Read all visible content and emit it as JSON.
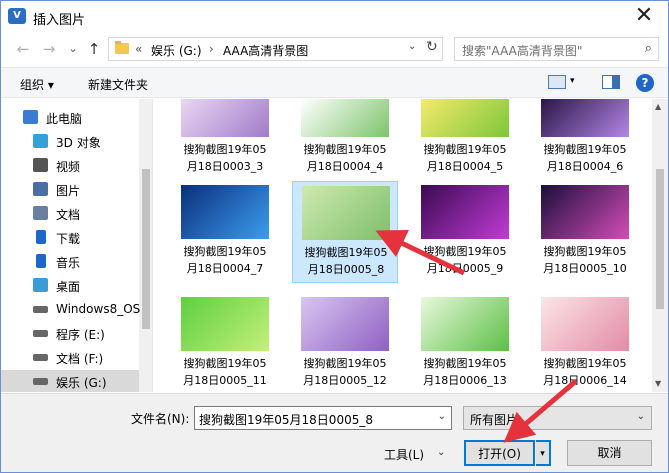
{
  "window": {
    "title": "插入图片",
    "app_icon_text": "V",
    "close_label": "✕"
  },
  "nav": {
    "back": "←",
    "forward": "→",
    "dropdown": "⌄",
    "up": "↑"
  },
  "address": {
    "sep": "«",
    "crumbs": [
      "娱乐 (G:)",
      "AAA高清背景图"
    ],
    "crumb_sep": "›",
    "dropdown": "⌄",
    "refresh": "↻"
  },
  "search": {
    "placeholder": "搜索\"AAA高清背景图\"",
    "icon": "⌕"
  },
  "toolbar": {
    "organize": "组织 ▾",
    "new_folder": "新建文件夹",
    "help": "?"
  },
  "sidebar": {
    "items": [
      {
        "label": "此电脑",
        "icon": "computer-icon",
        "color": "#3a7bd5"
      },
      {
        "label": "3D 对象",
        "icon": "cube-icon",
        "color": "#35a0d8"
      },
      {
        "label": "视频",
        "icon": "film-icon",
        "color": "#555555"
      },
      {
        "label": "图片",
        "icon": "picture-icon",
        "color": "#4a6fa5"
      },
      {
        "label": "文档",
        "icon": "document-icon",
        "color": "#6b7fa0"
      },
      {
        "label": "下载",
        "icon": "download-icon",
        "color": "#1e66c8"
      },
      {
        "label": "音乐",
        "icon": "music-icon",
        "color": "#1e66c8"
      },
      {
        "label": "桌面",
        "icon": "desktop-icon",
        "color": "#3a9bd5"
      },
      {
        "label": "Windows8_OS",
        "icon": "drive-icon",
        "color": "#666666"
      },
      {
        "label": "程序 (E:)",
        "icon": "drive-icon",
        "color": "#666666"
      },
      {
        "label": "文档 (F:)",
        "icon": "drive-icon",
        "color": "#666666"
      },
      {
        "label": "娱乐 (G:)",
        "icon": "drive-icon",
        "color": "#666666"
      }
    ]
  },
  "files": [
    {
      "line1": "搜狗截图19年05",
      "line2": "月18日0003_3",
      "c1": "#e9d6f3",
      "c2": "#a07cc9"
    },
    {
      "line1": "搜狗截图19年05",
      "line2": "月18日0004_4",
      "c1": "#ffffff",
      "c2": "#7cc46a"
    },
    {
      "line1": "搜狗截图19年05",
      "line2": "月18日0004_5",
      "c1": "#f5ea6a",
      "c2": "#7cc73b"
    },
    {
      "line1": "搜狗截图19年05",
      "line2": "月18日0004_6",
      "c1": "#2a1648",
      "c2": "#b486e6"
    },
    {
      "line1": "搜狗截图19年05",
      "line2": "月18日0004_7",
      "c1": "#0a2f7a",
      "c2": "#3c9cf0"
    },
    {
      "line1": "搜狗截图19年05",
      "line2": "月18日0005_8",
      "c1": "#cfe9b0",
      "c2": "#7dbf6a"
    },
    {
      "line1": "搜狗截图19年05",
      "line2": "月18日0005_9",
      "c1": "#3b0a52",
      "c2": "#c23bd6"
    },
    {
      "line1": "搜狗截图19年05",
      "line2": "月18日0005_10",
      "c1": "#1b0f3a",
      "c2": "#d54cb7"
    },
    {
      "line1": "搜狗截图19年05",
      "line2": "月18日0005_11",
      "c1": "#5fcf3f",
      "c2": "#c3f07a"
    },
    {
      "line1": "搜狗截图19年05",
      "line2": "月18日0005_12",
      "c1": "#d8c6ef",
      "c2": "#8f5fc4"
    },
    {
      "line1": "搜狗截图19年05",
      "line2": "月18日0006_13",
      "c1": "#e8f8dc",
      "c2": "#5cbf45"
    },
    {
      "line1": "搜狗截图19年05",
      "line2": "月18日0006_14",
      "c1": "#fbe6e6",
      "c2": "#e48aa6"
    }
  ],
  "selected_file": 5,
  "bottom": {
    "filename_label": "文件名(N):",
    "filename_value": "搜狗截图19年05月18日0005_8",
    "filetype_value": "所有图片",
    "tools": "工具(L)",
    "open": "打开(O)",
    "cancel": "取消",
    "dd": "⌄"
  },
  "colors": {
    "accent": "#0078d7",
    "arrow": "#e5323d"
  }
}
